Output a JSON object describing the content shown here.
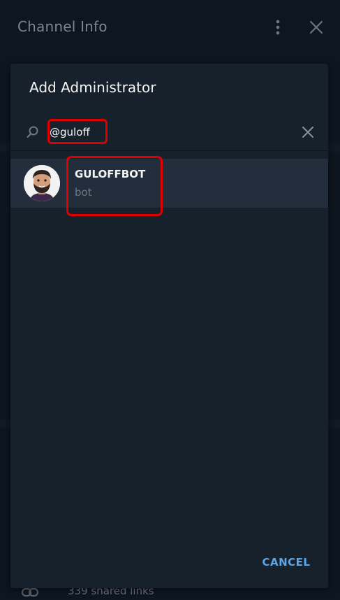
{
  "background": {
    "title": "Channel Info",
    "shared_links": "339 shared links",
    "more_icon": "more-vertical-icon",
    "close_icon": "close-icon",
    "link_icon": "link-icon"
  },
  "modal": {
    "title": "Add Administrator",
    "search": {
      "value": "@guloff",
      "search_icon": "search-icon",
      "clear_icon": "clear-icon"
    },
    "results": [
      {
        "name": "GULOFFBOT",
        "subtitle": "bot",
        "avatar": "cartoon-avatar"
      }
    ],
    "cancel_label": "CANCEL"
  },
  "colors": {
    "accent": "#5fa6e6",
    "highlight": "#e00000",
    "modal_bg": "#17212b",
    "selected_row_bg": "#232e3c"
  }
}
